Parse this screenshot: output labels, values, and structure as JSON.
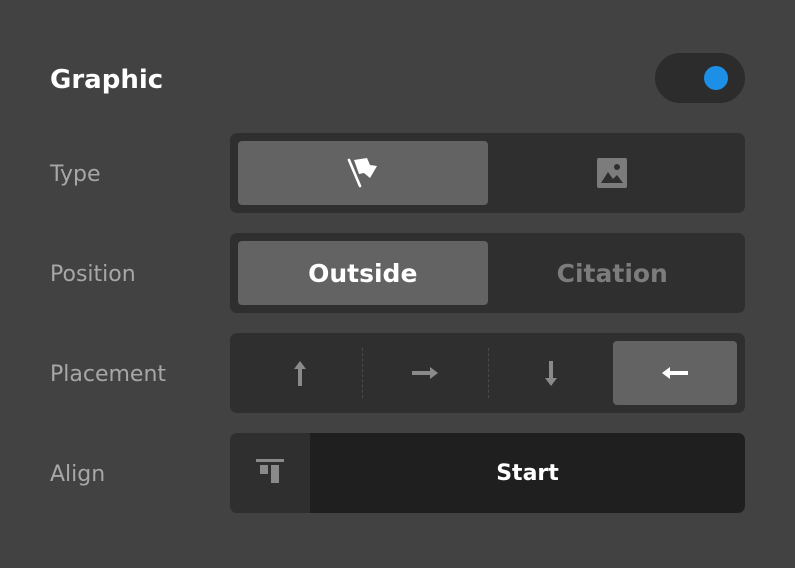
{
  "panel": {
    "title": "Graphic",
    "toggle_on": true,
    "accent_color": "#1e8fe6"
  },
  "rows": {
    "type": {
      "label": "Type",
      "options": [
        {
          "icon": "flag-icon",
          "selected": true
        },
        {
          "icon": "image-icon",
          "selected": false
        }
      ]
    },
    "position": {
      "label": "Position",
      "options": [
        {
          "label": "Outside",
          "selected": true
        },
        {
          "label": "Citation",
          "selected": false
        }
      ]
    },
    "placement": {
      "label": "Placement",
      "options": [
        {
          "icon": "arrow-up-icon",
          "selected": false
        },
        {
          "icon": "arrow-right-icon",
          "selected": false
        },
        {
          "icon": "arrow-down-icon",
          "selected": false
        },
        {
          "icon": "arrow-left-icon",
          "selected": true
        }
      ]
    },
    "align": {
      "label": "Align",
      "icon": "align-top-icon",
      "value": "Start"
    }
  }
}
